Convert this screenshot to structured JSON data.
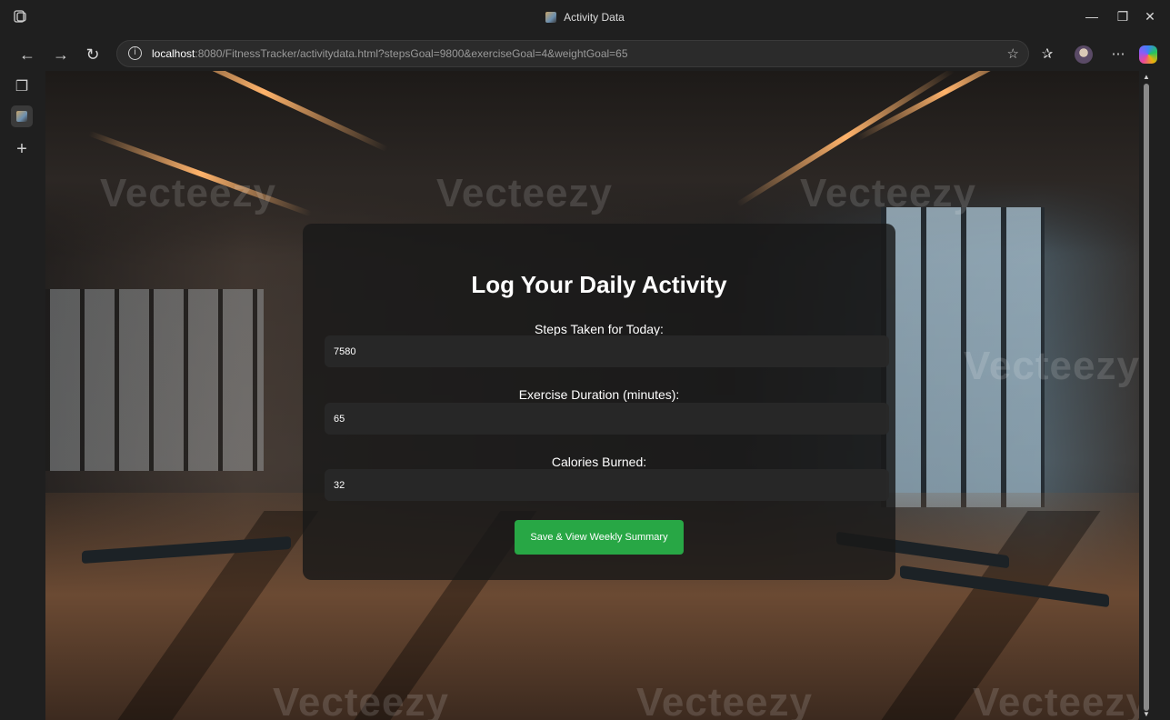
{
  "browser": {
    "tab_title": "Activity Data",
    "url_host": "localhost",
    "url_rest": ":8080/FitnessTracker/activitydata.html?stepsGoal=9800&exerciseGoal=4&weightGoal=65"
  },
  "page": {
    "heading": "Log Your Daily Activity",
    "fields": [
      {
        "label": "Steps Taken for Today:",
        "value": "7580"
      },
      {
        "label": "Exercise Duration (minutes):",
        "value": "65"
      },
      {
        "label": "Calories Burned:",
        "value": "32"
      }
    ],
    "submit_label": "Save & View Weekly Summary"
  },
  "watermark": "Vecteezy",
  "colors": {
    "button": "#28a745",
    "card": "rgba(25,25,25,0.82)"
  },
  "icons": [
    "back-icon",
    "forward-icon",
    "refresh-icon",
    "info-icon",
    "favorite-star-icon",
    "favorites-icon",
    "profile-avatar",
    "more-icon",
    "copilot-icon",
    "minimize-icon",
    "maximize-icon",
    "close-icon",
    "tab-actions-icon",
    "new-tab-icon"
  ]
}
